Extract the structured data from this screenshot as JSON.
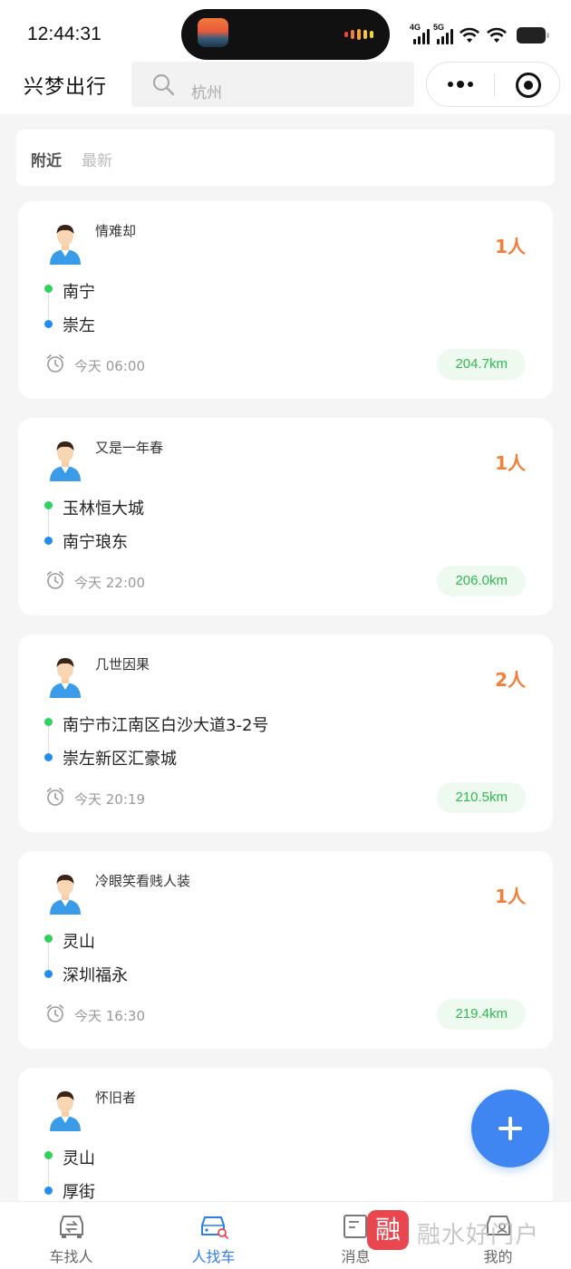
{
  "status_bar": {
    "time": "12:44:31",
    "signal_labels": [
      "4G",
      "5G"
    ]
  },
  "header": {
    "title": "兴梦出行",
    "search_placeholder": "杭州"
  },
  "filter_tabs": [
    {
      "label": "附近",
      "active": true
    },
    {
      "label": "最新",
      "active": false
    }
  ],
  "posts": [
    {
      "user": "情难却",
      "seats": "1人",
      "from": "南宁",
      "to": "崇左",
      "time": "今天 06:00",
      "distance": "204.7km"
    },
    {
      "user": "又是一年春",
      "seats": "1人",
      "from": "玉林恒大城",
      "to": "南宁琅东",
      "time": "今天 22:00",
      "distance": "206.0km"
    },
    {
      "user": "几世因果",
      "seats": "2人",
      "from": "南宁市江南区白沙大道3-2号",
      "to": "崇左新区汇豪城",
      "time": "今天 20:19",
      "distance": "210.5km"
    },
    {
      "user": "冷眼笑看贱人装",
      "seats": "1人",
      "from": "灵山",
      "to": "深圳福永",
      "time": "今天 16:30",
      "distance": "219.4km"
    },
    {
      "user": "怀旧者",
      "seats": "",
      "from": "灵山",
      "to": "厚街",
      "time": "",
      "distance": ""
    }
  ],
  "tabbar": [
    {
      "label": "车找人",
      "icon": "car-swap-icon",
      "active": false
    },
    {
      "label": "人找车",
      "icon": "car-search-icon",
      "active": true
    },
    {
      "label": "消息",
      "icon": "message-icon",
      "active": false
    },
    {
      "label": "我的",
      "icon": "profile-car-icon",
      "active": false
    }
  ],
  "watermark": {
    "logo": "融",
    "text": "融水好门户"
  },
  "colors": {
    "accent": "#3f86f2",
    "seats": "#f0803a",
    "distance": "#2fb84f",
    "from_dot": "#2ed25c",
    "to_dot": "#1f8ef0"
  }
}
